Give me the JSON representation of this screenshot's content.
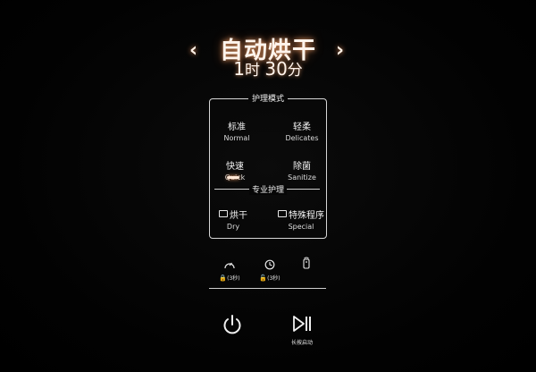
{
  "header": {
    "program_title": "自动烘干",
    "time_hours": "1",
    "time_hour_unit": "时",
    "time_minutes": "30",
    "time_minute_unit": "分",
    "prev_arrow": "‹",
    "next_arrow": "›"
  },
  "care_mode": {
    "legend": "护理模式",
    "options": [
      {
        "cn": "标准",
        "en": "Normal"
      },
      {
        "cn": "轻柔",
        "en": "Delicates"
      },
      {
        "cn": "快速",
        "en": "Quick"
      },
      {
        "cn": "除菌",
        "en": "Sanitize"
      }
    ]
  },
  "pro_care": {
    "label": "专业护理",
    "options": [
      {
        "cn": "烘干",
        "en": "Dry"
      },
      {
        "cn": "特殊程序",
        "en": "Special"
      }
    ]
  },
  "lock_row": {
    "items": [
      {
        "icon": "gauge-icon",
        "label": "(3秒)"
      },
      {
        "icon": "timer-icon",
        "label": "(3秒)"
      },
      {
        "icon": "remote-icon",
        "label": ""
      }
    ]
  },
  "controls": {
    "start_label": "长按启动",
    "power_icon": "power-icon",
    "start_icon": "play-pause-icon"
  },
  "colors": {
    "background": "#000000",
    "glow": "#ffaa6e",
    "text": "#f3f3f3"
  }
}
